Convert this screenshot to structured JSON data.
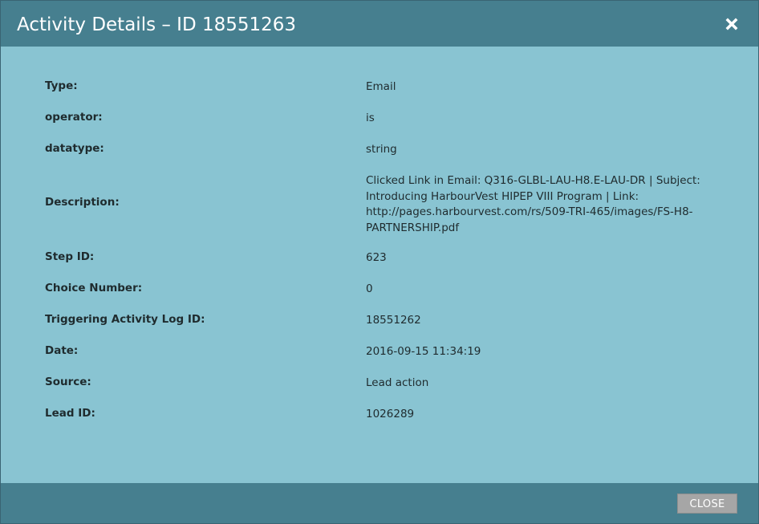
{
  "dialog": {
    "title": "Activity Details – ID 18551263",
    "close_icon": "close-icon",
    "close_button_label": "CLOSE"
  },
  "details": [
    {
      "label": "Type:",
      "value": "Email"
    },
    {
      "label": "operator:",
      "value": "is"
    },
    {
      "label": "datatype:",
      "value": "string"
    },
    {
      "label": "Description:",
      "value": "Clicked Link in Email: Q316-GLBL-LAU-H8.E-LAU-DR | Subject: Introducing HarbourVest HIPEP VIII Program | Link: http://pages.harbourvest.com/rs/509-TRI-465/images/FS-H8-PARTNERSHIP.pdf"
    },
    {
      "label": "Step ID:",
      "value": "623"
    },
    {
      "label": "Choice Number:",
      "value": "0"
    },
    {
      "label": "Triggering Activity Log ID:",
      "value": "18551262"
    },
    {
      "label": "Date:",
      "value": "2016-09-15 11:34:19"
    },
    {
      "label": "Source:",
      "value": "Lead action"
    },
    {
      "label": "Lead ID:",
      "value": "1026289"
    }
  ],
  "colors": {
    "header": "#467f8f",
    "body": "#89c4d2",
    "button": "#a6a6a6"
  }
}
